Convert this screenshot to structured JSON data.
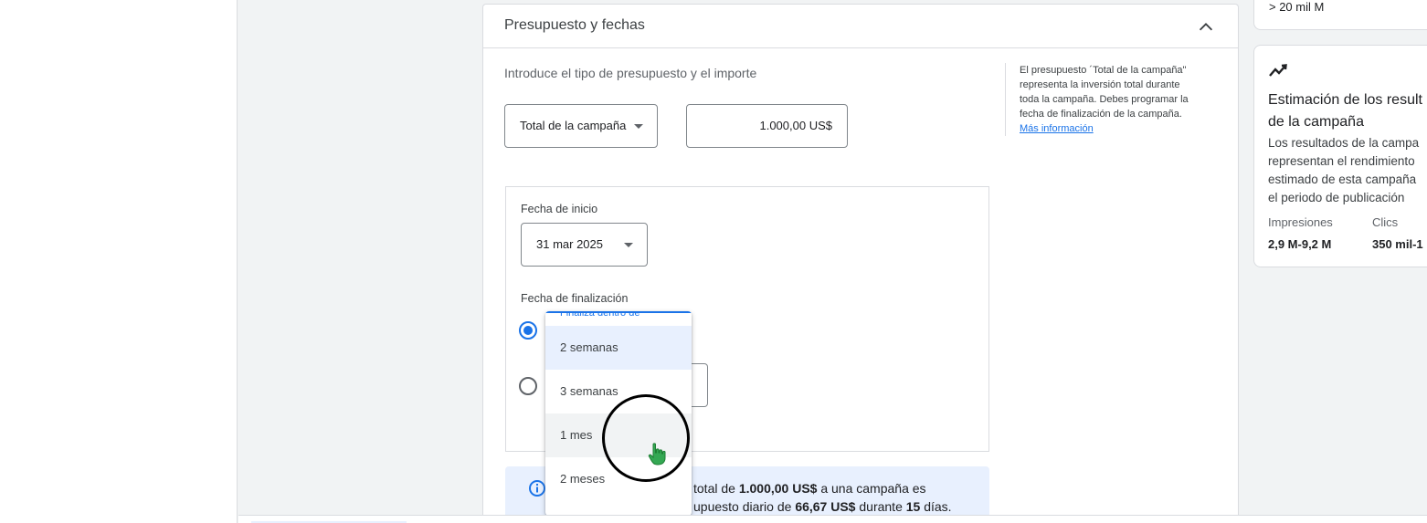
{
  "section": {
    "title": "Presupuesto y fechas",
    "intro": "Introduce el tipo de presupuesto y el importe",
    "budget_type": "Total de la campaña",
    "amount": "1.000,00 US$",
    "help_lines": [
      "El presupuesto ´Total de la campaña\"",
      "representa la inversión total durante",
      "toda la campaña. Debes programar la",
      "fecha de finalización de la campaña."
    ],
    "help_link": "Más información",
    "start_label": "Fecha de inicio",
    "start_value": "31 mar 2025",
    "end_label": "Fecha de finalización",
    "end_dropdown_label": "Finaliza dentro de",
    "end_options": [
      "2 semanas",
      "3 semanas",
      "1 mes",
      "2 meses"
    ],
    "info": {
      "line1_pre": "total de ",
      "line1_amount": "1.000,00 US$",
      "line1_post": " a una campaña es",
      "line2_pre": "upuesto diario de ",
      "line2_daily": "66,67 US$",
      "line2_mid": " durante ",
      "line2_days": "15",
      "line2_post": " días."
    }
  },
  "side": {
    "top_value": "> 20 mil M",
    "est_title_lines": [
      "Estimación de los result",
      "de la campaña"
    ],
    "est_desc_lines": [
      "Los resultados de la campa",
      "representan el rendimiento",
      "estimado de esta campaña",
      "el periodo de publicación"
    ],
    "metrics": [
      {
        "label": "Impresiones",
        "value": "2,9 M-9,2 M"
      },
      {
        "label": "Clics",
        "value": "350 mil-1"
      }
    ]
  },
  "colors": {
    "accent": "#1a73e8",
    "selected_bg": "#e8f0fe",
    "hover_bg": "#f1f3f4",
    "cursor_hand": "#34a853"
  },
  "icons": [
    "chevron-up-icon",
    "dropdown-arrow-icon",
    "info-icon",
    "trend-icon",
    "hand-cursor-icon"
  ]
}
